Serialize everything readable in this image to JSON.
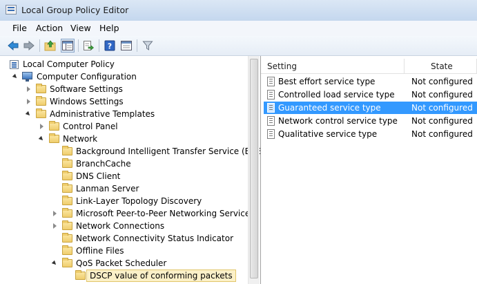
{
  "window": {
    "title": "Local Group Policy Editor"
  },
  "menu": [
    "File",
    "Action",
    "View",
    "Help"
  ],
  "toolbar": {
    "buttons": [
      "back-icon",
      "forward-icon",
      "up-folder-icon",
      "show-hide-tree-icon",
      "export-list-icon",
      "help-icon",
      "properties-icon",
      "filter-icon"
    ]
  },
  "tree": {
    "items": [
      {
        "label": "Local Computer Policy",
        "icon": "policy",
        "level": 0
      },
      {
        "label": "Computer Configuration",
        "icon": "computer",
        "level": 1,
        "state": "expanded"
      },
      {
        "label": "Software Settings",
        "icon": "folder",
        "level": 2,
        "state": "collapsed"
      },
      {
        "label": "Windows Settings",
        "icon": "folder",
        "level": 2,
        "state": "collapsed"
      },
      {
        "label": "Administrative Templates",
        "icon": "folder",
        "level": 2,
        "state": "expanded"
      },
      {
        "label": "Control Panel",
        "icon": "folder",
        "level": 3,
        "state": "collapsed"
      },
      {
        "label": "Network",
        "icon": "folder",
        "level": 3,
        "state": "expanded"
      },
      {
        "label": "Background Intelligent Transfer Service (BITS)",
        "icon": "folder",
        "level": 4
      },
      {
        "label": "BranchCache",
        "icon": "folder",
        "level": 4
      },
      {
        "label": "DNS Client",
        "icon": "folder",
        "level": 4
      },
      {
        "label": "Lanman Server",
        "icon": "folder",
        "level": 4
      },
      {
        "label": "Link-Layer Topology Discovery",
        "icon": "folder",
        "level": 4
      },
      {
        "label": "Microsoft Peer-to-Peer Networking Services",
        "icon": "folder",
        "level": 4,
        "state": "collapsed"
      },
      {
        "label": "Network Connections",
        "icon": "folder",
        "level": 4,
        "state": "collapsed"
      },
      {
        "label": "Network Connectivity Status Indicator",
        "icon": "folder",
        "level": 4
      },
      {
        "label": "Offline Files",
        "icon": "folder",
        "level": 4
      },
      {
        "label": "QoS Packet Scheduler",
        "icon": "folder",
        "level": 4,
        "state": "expanded"
      },
      {
        "label": "DSCP value of conforming packets",
        "icon": "folder",
        "level": 5,
        "selected": true
      }
    ]
  },
  "list": {
    "columns": [
      "Setting",
      "State"
    ],
    "rows": [
      {
        "setting": "Best effort service type",
        "state": "Not configured"
      },
      {
        "setting": "Controlled load service type",
        "state": "Not configured"
      },
      {
        "setting": "Guaranteed service type",
        "state": "Not configured",
        "selected": true
      },
      {
        "setting": "Network control service type",
        "state": "Not configured"
      },
      {
        "setting": "Qualitative service type",
        "state": "Not configured"
      }
    ]
  },
  "colors": {
    "selection": "#3399ff",
    "tree_selection": "#fbf0c8",
    "folder": "#efcd6d"
  }
}
